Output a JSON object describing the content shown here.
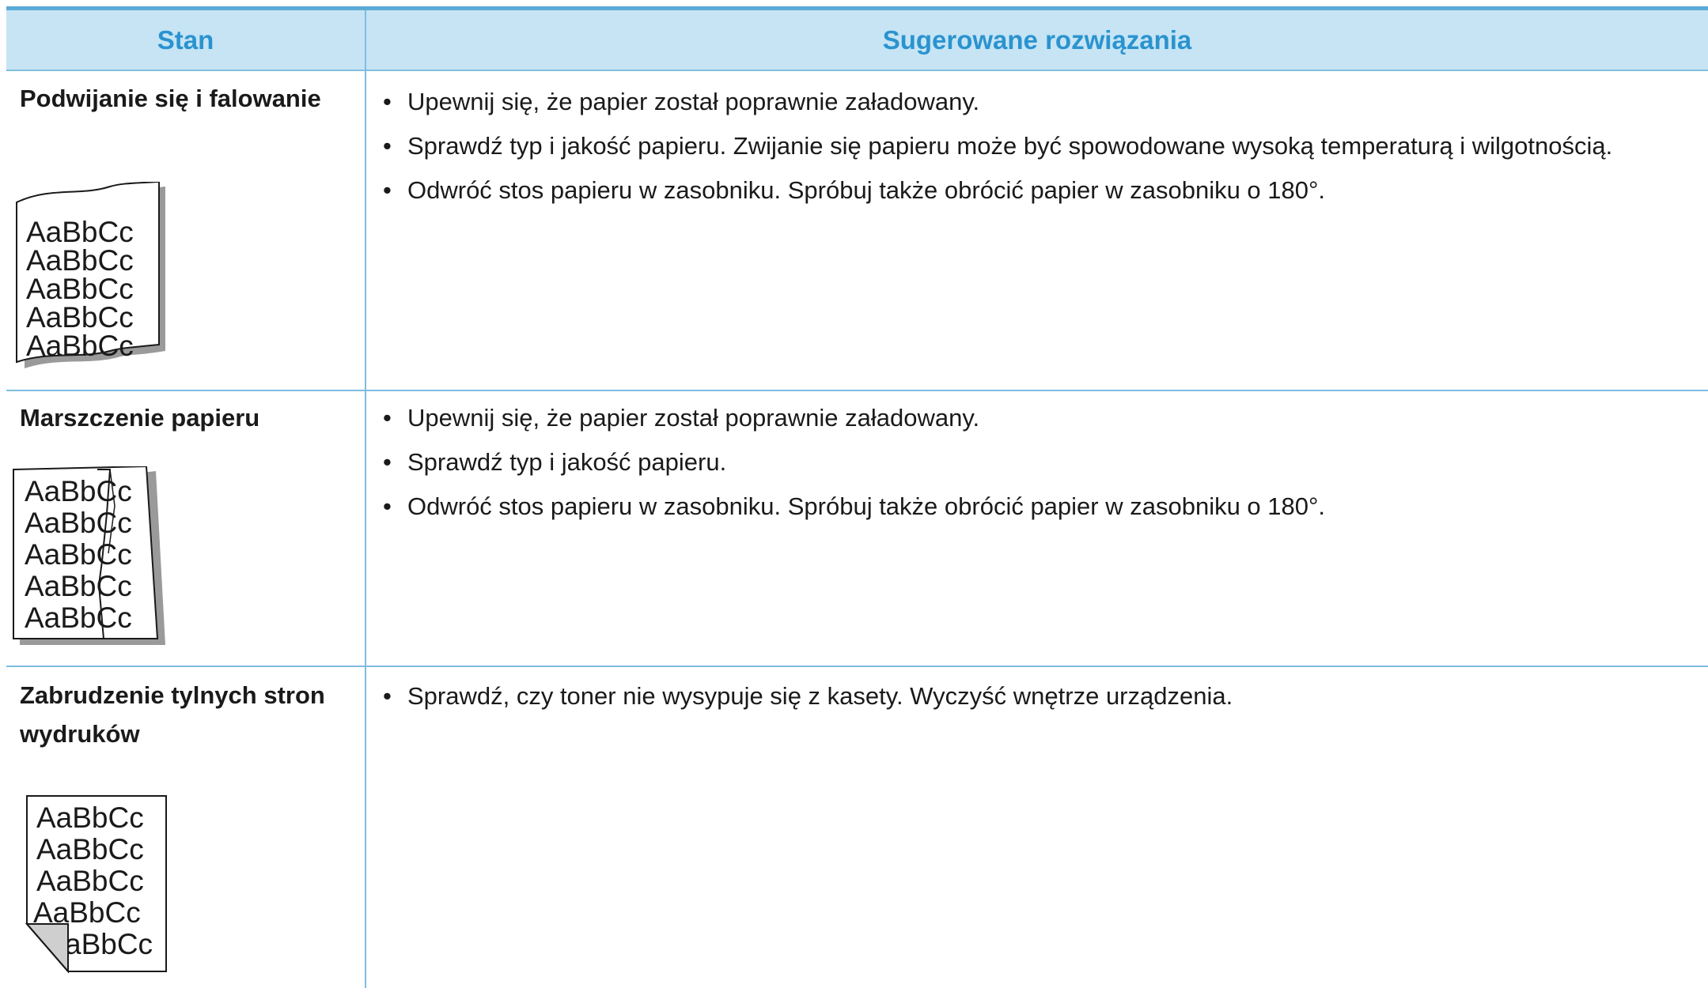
{
  "header": {
    "col_condition": "Stan",
    "col_solutions": "Sugerowane rozwiązania"
  },
  "colors": {
    "header_bg": "#c6e4f4",
    "header_text": "#2a93cf",
    "rule": "#7fbde0",
    "top_rule": "#5aaad6"
  },
  "rows": [
    {
      "condition": "Podwijanie się i falowanie",
      "sample_lines": [
        "AaBbCc",
        "AaBbCc",
        "AaBbCc",
        "AaBbCc",
        "AaBbCc"
      ],
      "illustration": "curled-paper-icon",
      "solutions": [
        "Upewnij się, że papier został poprawnie załadowany.",
        "Sprawdź typ i jakość papieru. Zwijanie się papieru może być spowodowane wysoką temperaturą i wilgotnością.",
        "Odwróć stos papieru w zasobniku. Spróbuj także obrócić papier w zasobniku o 180°."
      ]
    },
    {
      "condition": "Marszczenie papieru",
      "sample_lines": [
        "AaBbCc",
        "AaBbCc",
        "AaBbCc",
        "AaBbCc",
        "AaBbCc"
      ],
      "illustration": "wrinkled-paper-icon",
      "solutions": [
        "Upewnij się, że papier został poprawnie załadowany.",
        "Sprawdź typ i jakość papieru.",
        "Odwróć stos papieru w zasobniku. Spróbuj także obrócić papier w zasobniku o 180°."
      ]
    },
    {
      "condition": "Zabrudzenie tylnych stron wydruków",
      "sample_lines": [
        "AaBbCc",
        "AaBbCc",
        "AaBbCc",
        "AaBbCc",
        "aBbCc"
      ],
      "illustration": "folded-corner-paper-icon",
      "solutions": [
        "Sprawdź, czy toner nie wysypuje się z kasety. Wyczyść wnętrze urządzenia."
      ]
    }
  ]
}
